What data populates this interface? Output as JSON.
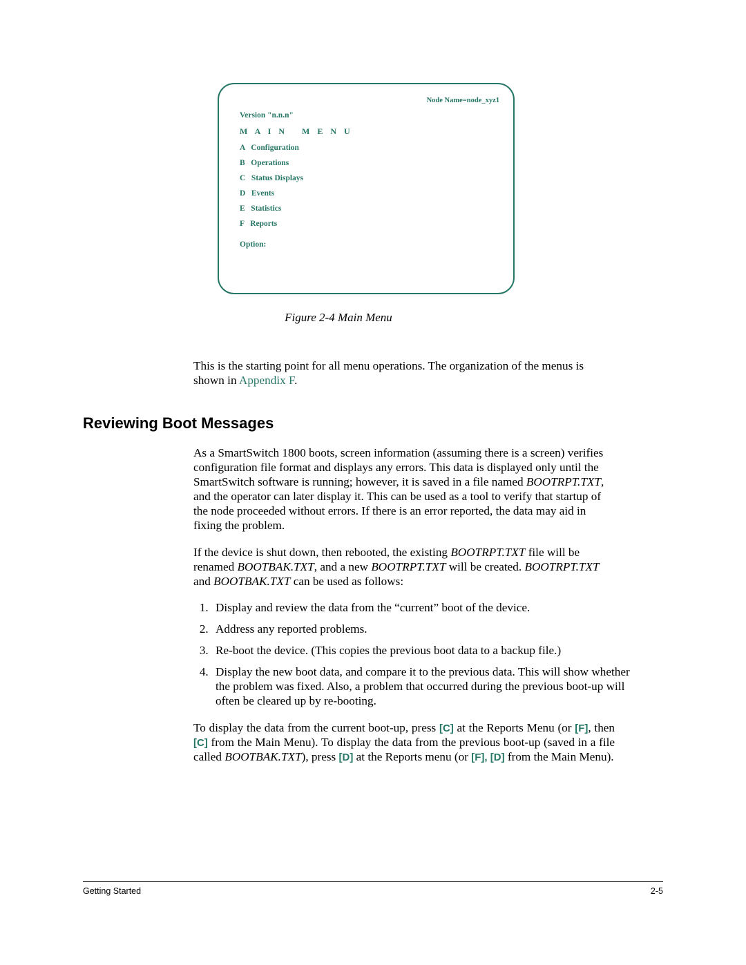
{
  "terminal": {
    "node_line": "Node Name=node_xyz1",
    "version": "Version \"n.n.n\"",
    "title": "M A I N   M E N U",
    "items": [
      "A   Configuration",
      "B   Operations",
      "C   Status Displays",
      "D   Events",
      "E   Statistics",
      "F   Reports"
    ],
    "prompt": "Option:"
  },
  "figure_caption": "Figure 2-4    Main Menu",
  "intro_para_pre": "This is the starting point for all menu operations. The organization of the menus is shown in ",
  "appendix_link": "Appendix F",
  "intro_para_post": ".",
  "section_heading": "Reviewing Boot Messages",
  "rev_para1_a": "As a SmartSwitch 1800 boots, screen information (assuming there is a screen) verifies configuration file format and displays any errors. This data is displayed only until the SmartSwitch software is running; however, it is saved in a file named ",
  "bootrpt": "BOOTRPT.TXT",
  "rev_para1_b": ", and the operator can later display it. This can be used as a tool to verify that startup of the node proceeded without errors. If there is an error reported, the data may aid in fixing the problem.",
  "rev_para2_a": "If the device is shut down, then rebooted, the existing ",
  "rev_para2_b": " file will be renamed ",
  "bootbak": "BOOTBAK.TXT",
  "rev_para2_c": ", and a new ",
  "rev_para2_d": " will be created. ",
  "rev_para2_e": " and ",
  "rev_para2_f": " can be used as follows:",
  "steps": [
    "Display and review the data from the “current” boot of the device.",
    "Address any reported problems.",
    "Re-boot the device. (This copies the previous boot data to a backup file.)",
    "Display the new boot data, and compare it to the previous data. This will show whether the problem was fixed. Also, a problem that occurred during the previous boot-up will often be cleared up by re-booting."
  ],
  "final_a": "To display the data from the current boot-up, press ",
  "key_c": "[C]",
  "final_b": " at the Reports Menu (or ",
  "key_f": "[F]",
  "final_c": ", then ",
  "final_d": " from the Main Menu). To display the data from the previous boot-up (saved in a file called ",
  "final_e": "),  press ",
  "key_d": "[D]",
  "final_f": " at the Reports menu (or ",
  "final_g": ", ",
  "final_h": " from the Main Menu).",
  "footer": {
    "left": "Getting Started",
    "right": "2-5"
  }
}
